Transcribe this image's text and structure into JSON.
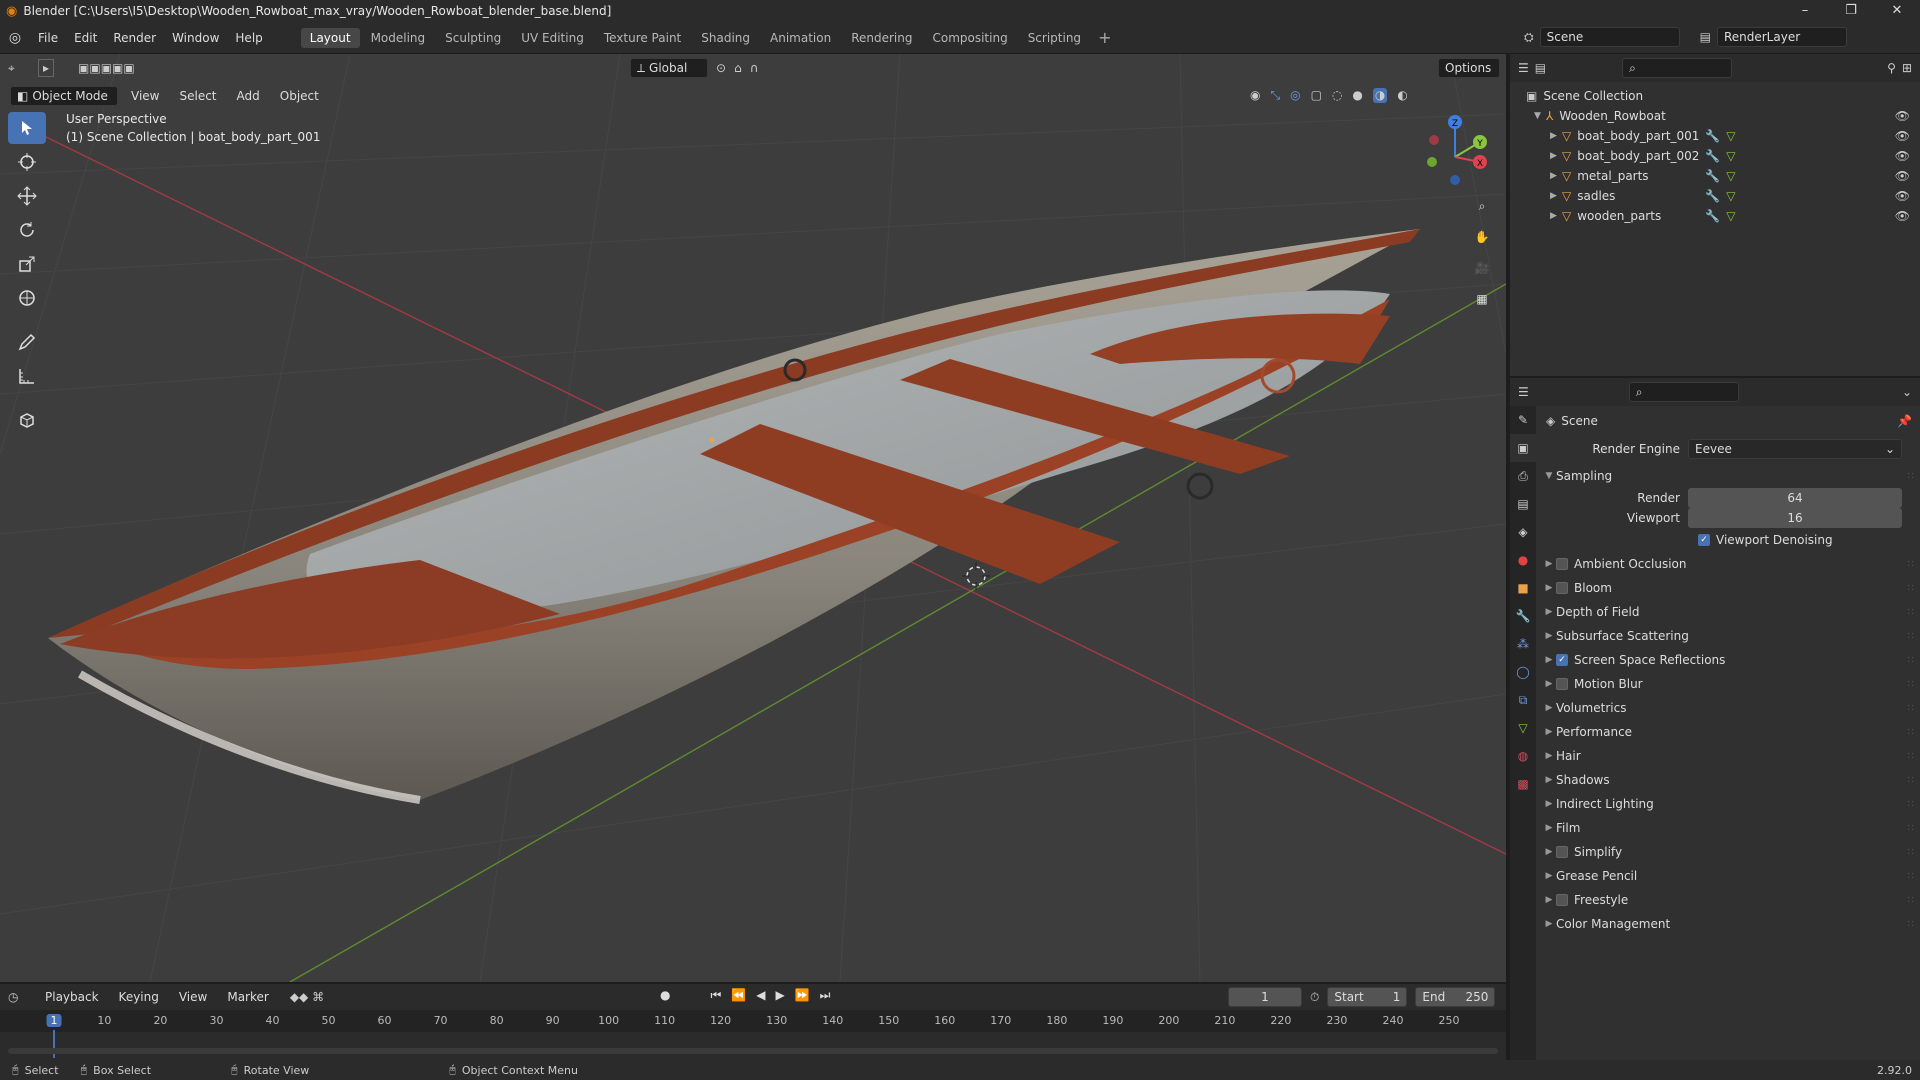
{
  "window": {
    "title": "Blender [C:\\Users\\I5\\Desktop\\Wooden_Rowboat_max_vray/Wooden_Rowboat_blender_base.blend]",
    "controls": [
      "–",
      "❐",
      "✕"
    ]
  },
  "menus": [
    "File",
    "Edit",
    "Render",
    "Window",
    "Help"
  ],
  "workspaces": [
    "Layout",
    "Modeling",
    "Sculpting",
    "UV Editing",
    "Texture Paint",
    "Shading",
    "Animation",
    "Rendering",
    "Compositing",
    "Scripting"
  ],
  "active_workspace": "Layout",
  "scene_field": "Scene",
  "view_layer_field": "RenderLayer",
  "viewport": {
    "mode": "Object Mode",
    "menus": [
      "View",
      "Select",
      "Add",
      "Object"
    ],
    "transform_orientation": "Global",
    "options_label": "Options",
    "info_line1": "User Perspective",
    "info_line2": "(1) Scene Collection | boat_body_part_001"
  },
  "gizmo": {
    "z": "Z",
    "y": "Y",
    "x": "X"
  },
  "outliner": {
    "root": "Scene Collection",
    "collection": "Wooden_Rowboat",
    "objects": [
      "boat_body_part_001",
      "boat_body_part_002",
      "metal_parts",
      "sadles",
      "wooden_parts"
    ]
  },
  "properties": {
    "context": "Scene",
    "render_engine_label": "Render Engine",
    "render_engine": "Eevee",
    "sampling": {
      "title": "Sampling",
      "render_label": "Render",
      "render_value": "64",
      "viewport_label": "Viewport",
      "viewport_value": "16",
      "denoise_label": "Viewport Denoising",
      "denoise_checked": true
    },
    "sections": [
      {
        "label": "Ambient Occlusion",
        "checkbox": true,
        "checked": false
      },
      {
        "label": "Bloom",
        "checkbox": true,
        "checked": false
      },
      {
        "label": "Depth of Field",
        "checkbox": false
      },
      {
        "label": "Subsurface Scattering",
        "checkbox": false
      },
      {
        "label": "Screen Space Reflections",
        "checkbox": true,
        "checked": true
      },
      {
        "label": "Motion Blur",
        "checkbox": true,
        "checked": false
      },
      {
        "label": "Volumetrics",
        "checkbox": false
      },
      {
        "label": "Performance",
        "checkbox": false
      },
      {
        "label": "Hair",
        "checkbox": false
      },
      {
        "label": "Shadows",
        "checkbox": false
      },
      {
        "label": "Indirect Lighting",
        "checkbox": false
      },
      {
        "label": "Film",
        "checkbox": false
      },
      {
        "label": "Simplify",
        "checkbox": true,
        "checked": false
      },
      {
        "label": "Grease Pencil",
        "checkbox": false
      },
      {
        "label": "Freestyle",
        "checkbox": true,
        "checked": false
      },
      {
        "label": "Color Management",
        "checkbox": false
      }
    ]
  },
  "timeline": {
    "menus": [
      "Playback",
      "Keying",
      "View",
      "Marker"
    ],
    "current_frame": "1",
    "start_label": "Start",
    "start": "1",
    "end_label": "End",
    "end": "250",
    "ticks": [
      "1",
      "10",
      "20",
      "30",
      "40",
      "50",
      "60",
      "70",
      "80",
      "90",
      "100",
      "110",
      "120",
      "130",
      "140",
      "150",
      "160",
      "170",
      "180",
      "190",
      "200",
      "210",
      "220",
      "230",
      "240",
      "250"
    ]
  },
  "status": {
    "select": "Select",
    "box_select": "Box Select",
    "rotate": "Rotate View",
    "context_menu": "Object Context Menu",
    "version": "2.92.0"
  },
  "colors": {
    "accent": "#4772b3",
    "x_axis": "#e0424f",
    "y_axis": "#8ac53e",
    "z_axis": "#3f7fe0",
    "object_orange": "#e8a34b"
  }
}
